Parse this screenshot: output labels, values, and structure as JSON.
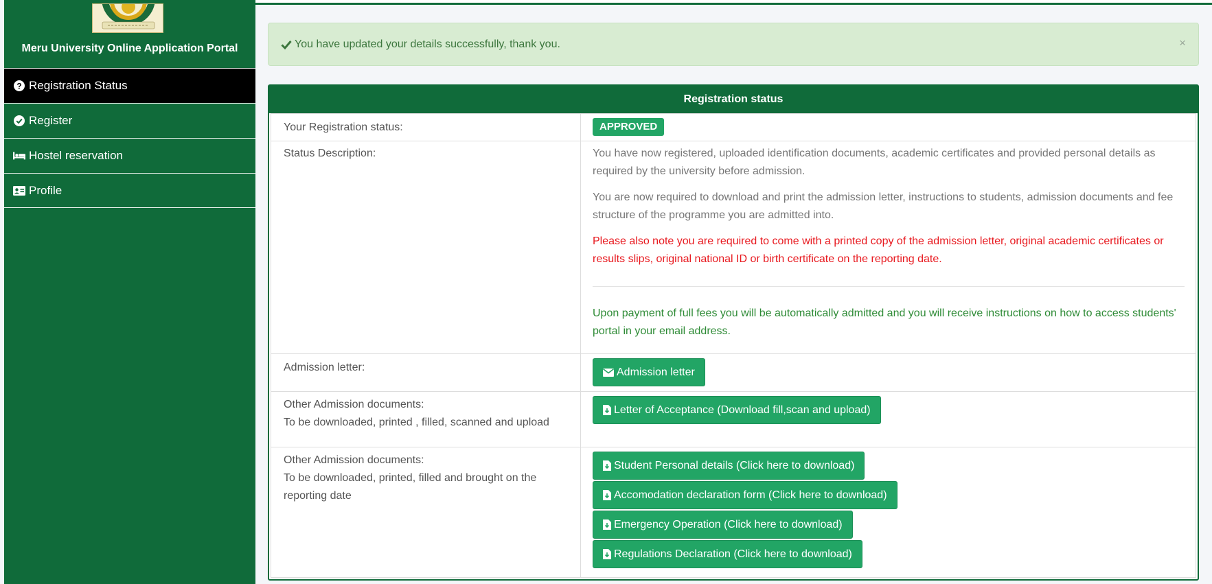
{
  "sidebar": {
    "portal_title": "Meru University Online Application Portal",
    "items": [
      {
        "label": "Registration Status",
        "icon": "question-circle-icon"
      },
      {
        "label": "Register",
        "icon": "check-circle-icon"
      },
      {
        "label": "Hostel reservation",
        "icon": "bed-icon"
      },
      {
        "label": "Profile",
        "icon": "id-card-icon"
      }
    ]
  },
  "alert": {
    "message": "You have updated your details successfully, thank you.",
    "close": "×"
  },
  "panel": {
    "title": "Registration status",
    "rows": {
      "status_label": "Your Registration status:",
      "status_value": "APPROVED",
      "description_label": "Status Description:",
      "description": {
        "p1": "You have now registered, uploaded identification documents, academic certificates and provided personal details as required by the university before admission.",
        "p2": "You are now required to download and print the admission letter, instructions to students, admission documents and fee structure of the programme you are admitted into.",
        "p3": "Please also note you are required to come with a printed copy of the admission letter, original academic certificates or results slips, original national ID or birth certificate on the reporting date.",
        "p4": "Upon payment of full fees you will be automatically admitted and you will receive instructions on how to access students' portal in your email address."
      },
      "admission_label": "Admission letter:",
      "admission_button": "Admission letter",
      "other1_label_a": "Other Admission documents:",
      "other1_label_b": "To be downloaded, printed , filled, scanned and upload",
      "other1_button": "Letter of Acceptance (Download fill,scan and upload)",
      "other2_label_a": "Other Admission documents:",
      "other2_label_b": "To be downloaded, printed, filled and brought on the reporting date",
      "other2_buttons": [
        "Student Personal details (Click here to download)",
        "Accomodation declaration form (Click here to download)",
        "Emergency Operation (Click here to download)",
        "Regulations Declaration (Click here to download)"
      ]
    }
  },
  "colors": {
    "brand_green": "#106b3a",
    "button_green": "#22a565",
    "alert_bg": "#d8ecd2",
    "warning_red": "#e8191f",
    "note_green": "#2e8b36"
  }
}
